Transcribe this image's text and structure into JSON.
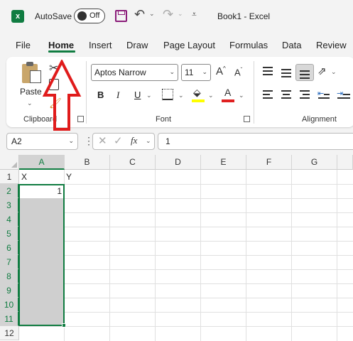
{
  "titlebar": {
    "app_icon_letter": "x",
    "autosave_label": "AutoSave",
    "autosave_state": "Off",
    "title": "Book1  -  Excel"
  },
  "tabs": [
    "File",
    "Home",
    "Insert",
    "Draw",
    "Page Layout",
    "Formulas",
    "Data",
    "Review"
  ],
  "active_tab": "Home",
  "ribbon": {
    "clipboard": {
      "paste_label": "Paste",
      "group_label": "Clipboard"
    },
    "font": {
      "font_name": "Aptos Narrow",
      "font_size": "11",
      "grow_label": "A^",
      "shrink_label": "A˅",
      "bold_label": "B",
      "italic_label": "I",
      "underline_label": "U",
      "fill_letter": "A",
      "fontcolor_letter": "A",
      "group_label": "Font",
      "fill_color": "#ffff00",
      "font_color": "#e02020"
    },
    "alignment": {
      "group_label": "Alignment"
    }
  },
  "formula_bar": {
    "name_box": "A2",
    "fx_label": "fx",
    "formula_value": "1"
  },
  "grid": {
    "columns": [
      "A",
      "B",
      "C",
      "D",
      "E",
      "F",
      "G"
    ],
    "rows": [
      "1",
      "2",
      "3",
      "4",
      "5",
      "6",
      "7",
      "8",
      "9",
      "10",
      "11",
      "12"
    ],
    "selected_column": "A",
    "selected_range": "A2:A11",
    "cells": {
      "A1": "X",
      "B1": "Y",
      "A2": "1"
    }
  },
  "colors": {
    "accent": "#107c41",
    "annotation_arrow": "#e01b1b"
  }
}
